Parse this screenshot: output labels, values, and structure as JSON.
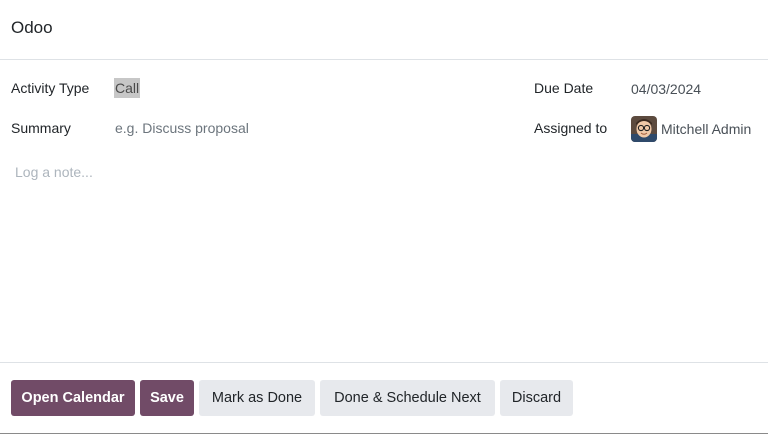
{
  "dialog": {
    "title": "Odoo"
  },
  "form": {
    "activity_type_label": "Activity Type",
    "activity_type_value": "Call",
    "summary_label": "Summary",
    "summary_placeholder": "e.g. Discuss proposal",
    "due_date_label": "Due Date",
    "due_date_value": "04/03/2024",
    "assigned_to_label": "Assigned to",
    "assigned_to_value": "Mitchell Admin",
    "note_placeholder": "Log a note..."
  },
  "footer": {
    "open_calendar_label": "Open Calendar",
    "save_label": "Save",
    "mark_done_label": "Mark as Done",
    "done_next_label": "Done & Schedule Next",
    "discard_label": "Discard"
  },
  "colors": {
    "primary": "#714b67",
    "secondary": "#e7e9ed",
    "selection_highlight": "#c7c7c7"
  },
  "icons": {
    "avatar": "user-avatar-icon"
  }
}
